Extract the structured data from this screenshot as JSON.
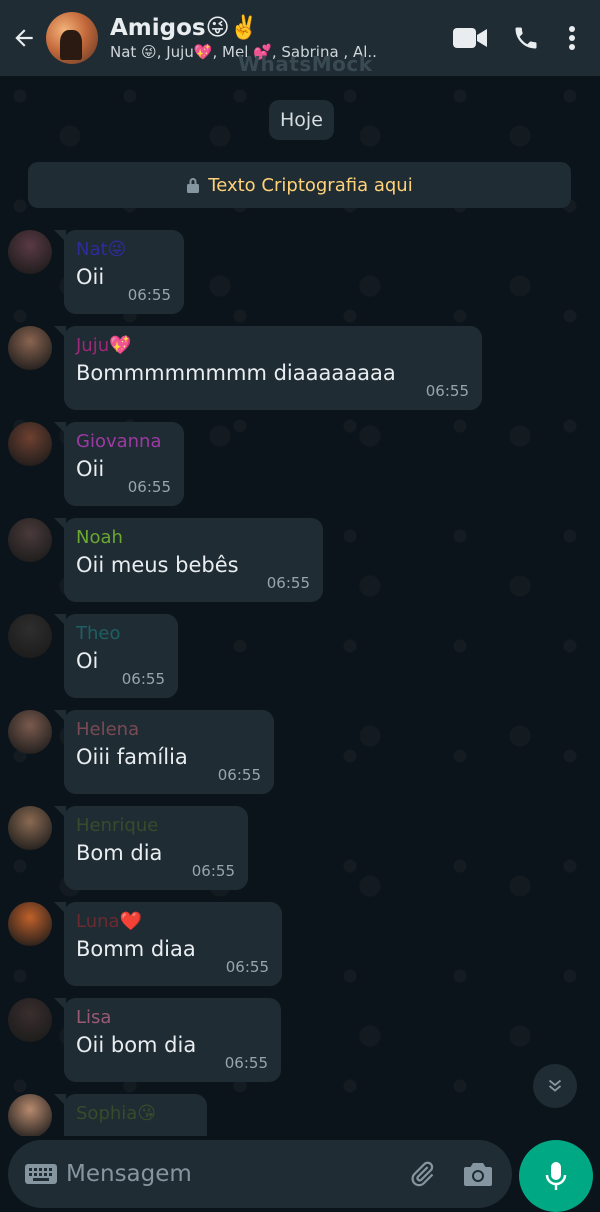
{
  "header": {
    "title": "Amigos😜✌️",
    "subtitle": "Nat 😜, Juju💖, Mel 💕, Sabrina , Al..",
    "watermark": "WhatsMock"
  },
  "date_chip": "Hoje",
  "encryption_banner": "Texto Criptografia aqui",
  "messages": [
    {
      "sender": "Nat😜",
      "text": "Oii",
      "time": "06:55",
      "sender_color": "#2c2c9c",
      "avatar_color": "#5a3a44"
    },
    {
      "sender": "Juju💖",
      "text": "Bommmmmmmm diaaaaaaaa",
      "time": "06:55",
      "sender_color": "#a0277a",
      "avatar_color": "#8a6450"
    },
    {
      "sender": "Giovanna",
      "text": "Oii",
      "time": "06:55",
      "sender_color": "#9c3aa3",
      "avatar_color": "#6e4030"
    },
    {
      "sender": "Noah",
      "text": "Oii meus bebês",
      "time": "06:55",
      "sender_color": "#6aa830",
      "avatar_color": "#4a3a3a"
    },
    {
      "sender": "Theo",
      "text": "Oi",
      "time": "06:55",
      "sender_color": "#1f5f63",
      "avatar_color": "#2e2e2e"
    },
    {
      "sender": "Helena",
      "text": "Oiii família",
      "time": "06:55",
      "sender_color": "#7a4a54",
      "avatar_color": "#7a5a4e"
    },
    {
      "sender": "Henrique",
      "text": "Bom dia",
      "time": "06:55",
      "sender_color": "#3a4a2a",
      "avatar_color": "#8a6a52"
    },
    {
      "sender": "Luna❤️",
      "text": "Bomm diaa",
      "time": "06:55",
      "sender_color": "#6a2a30",
      "avatar_color": "#c0602a"
    },
    {
      "sender": "Lisa",
      "text": "Oii bom dia",
      "time": "06:55",
      "sender_color": "#9a5a74",
      "avatar_color": "#3a2e2e"
    },
    {
      "sender": "Sophia😘",
      "text": "",
      "time": "",
      "sender_color": "#3a4a2a",
      "avatar_color": "#b88a6e"
    }
  ],
  "composer": {
    "placeholder": "Mensagem"
  },
  "colors": {
    "header_bg": "#1f2c34",
    "chat_bg": "#0b141a",
    "bubble_bg": "#1f2c34",
    "accent": "#00a884",
    "banner_text": "#ffd279"
  },
  "icons": {
    "back": "arrow-left-icon",
    "video": "video-camera-icon",
    "call": "phone-icon",
    "menu": "kebab-menu-icon",
    "lock": "lock-icon",
    "scroll": "double-chevron-down-icon",
    "keyboard": "keyboard-icon",
    "attach": "paperclip-icon",
    "camera": "camera-icon",
    "mic": "microphone-icon"
  }
}
